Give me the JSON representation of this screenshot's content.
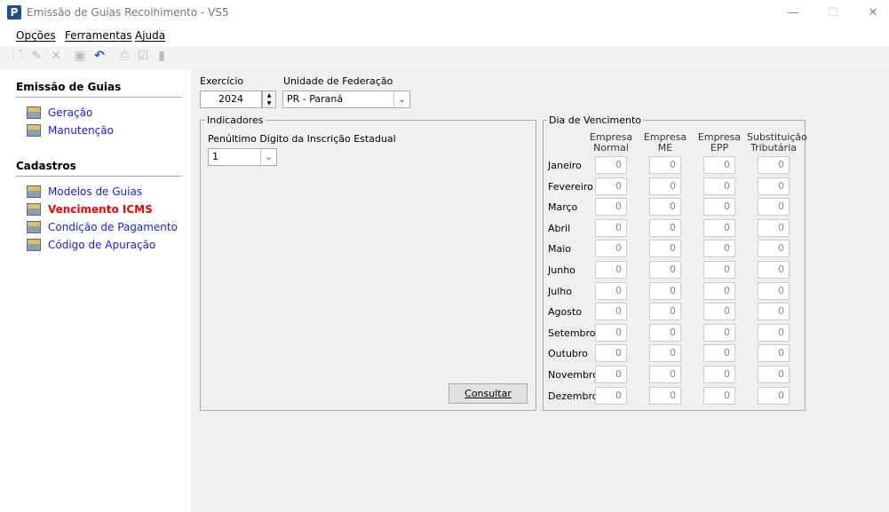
{
  "window": {
    "title": "Emissão de Guias Recolhimento - VS5",
    "icon_letter": "P",
    "minimize": "—",
    "maximize": "☐",
    "close": "✕"
  },
  "menu": [
    "Opções",
    "Ferramentas",
    "Ajuda"
  ],
  "toolbar": [
    "new-icon",
    "edit-icon",
    "delete-icon",
    "save-icon",
    "undo-icon",
    "print-icon",
    "check-icon",
    "document-icon"
  ],
  "sidebar": {
    "sections": [
      {
        "title": "Emissão de Guias",
        "items": [
          {
            "label": "Geração"
          },
          {
            "label": "Manutenção"
          }
        ]
      },
      {
        "title": "Cadastros",
        "items": [
          {
            "label": "Modelos de Guias"
          },
          {
            "label": "Vencimento ICMS",
            "active": true
          },
          {
            "label": "Condição de Pagamento"
          },
          {
            "label": "Código de Apuração"
          }
        ]
      }
    ]
  },
  "form": {
    "exercicio_label": "Exercício",
    "exercicio_value": "2024",
    "uf_label": "Unidade de Federação",
    "uf_value": "PR - Paraná"
  },
  "indicadores": {
    "title": "Indicadores",
    "digit_label": "Penúltimo Dígito da Inscrição Estadual",
    "digit_value": "1",
    "consultar": "Consultar"
  },
  "vencimento": {
    "title": "Dia de Vencimento",
    "columns": [
      [
        "Empresa",
        "Normal"
      ],
      [
        "Empresa",
        "ME"
      ],
      [
        "Empresa",
        "EPP"
      ],
      [
        "Substituição",
        "Tributária"
      ]
    ],
    "rows": [
      {
        "month": "Janeiro",
        "values": [
          "0",
          "0",
          "0",
          "0"
        ]
      },
      {
        "month": "Fevereiro",
        "values": [
          "0",
          "0",
          "0",
          "0"
        ]
      },
      {
        "month": "Março",
        "values": [
          "0",
          "0",
          "0",
          "0"
        ]
      },
      {
        "month": "Abril",
        "values": [
          "0",
          "0",
          "0",
          "0"
        ]
      },
      {
        "month": "Maio",
        "values": [
          "0",
          "0",
          "0",
          "0"
        ]
      },
      {
        "month": "Junho",
        "values": [
          "0",
          "0",
          "0",
          "0"
        ]
      },
      {
        "month": "Julho",
        "values": [
          "0",
          "0",
          "0",
          "0"
        ]
      },
      {
        "month": "Agosto",
        "values": [
          "0",
          "0",
          "0",
          "0"
        ]
      },
      {
        "month": "Setembro",
        "values": [
          "0",
          "0",
          "0",
          "0"
        ]
      },
      {
        "month": "Outubro",
        "values": [
          "0",
          "0",
          "0",
          "0"
        ]
      },
      {
        "month": "Novembro",
        "values": [
          "0",
          "0",
          "0",
          "0"
        ]
      },
      {
        "month": "Dezembro",
        "values": [
          "0",
          "0",
          "0",
          "0"
        ]
      }
    ]
  }
}
